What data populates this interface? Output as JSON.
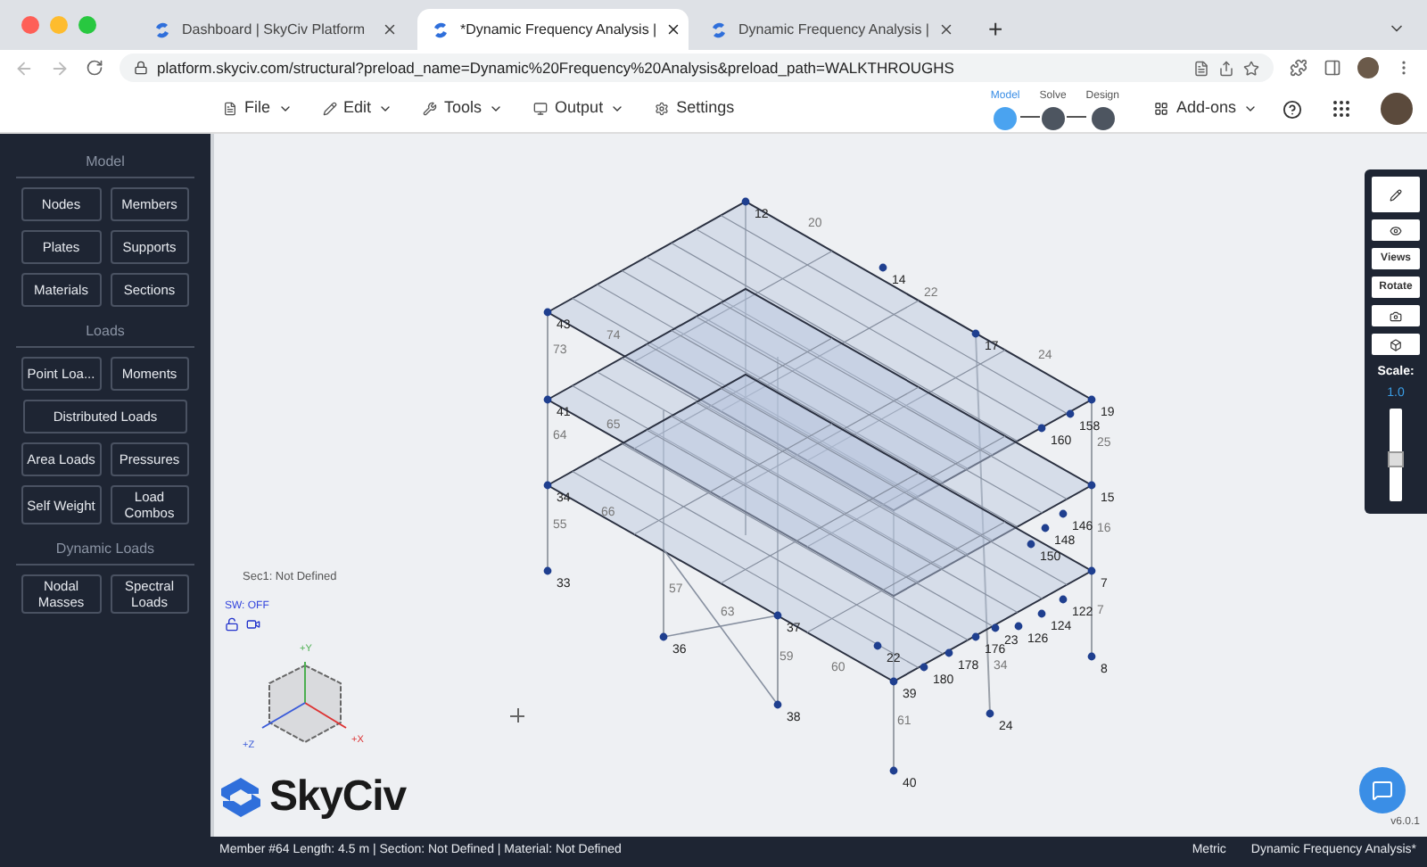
{
  "browser": {
    "tabs": [
      {
        "title": "Dashboard | SkyCiv Platform",
        "selected": false
      },
      {
        "title": "*Dynamic Frequency Analysis |",
        "selected": true
      },
      {
        "title": "Dynamic Frequency Analysis |",
        "selected": false
      }
    ],
    "new_tab": "+",
    "url": "platform.skyciv.com/structural?preload_name=Dynamic%20Frequency%20Analysis&preload_path=WALKTHROUGHS"
  },
  "toolbar": {
    "menus": [
      "File",
      "Edit",
      "Tools",
      "Output",
      "Settings"
    ],
    "steps": [
      {
        "label": "Model",
        "selected": true
      },
      {
        "label": "Solve",
        "selected": false
      },
      {
        "label": "Design",
        "selected": false
      }
    ],
    "addons": "Add-ons"
  },
  "sidebar": {
    "sections": [
      {
        "title": "Model",
        "buttons": [
          {
            "label": "Nodes",
            "wide": false
          },
          {
            "label": "Members",
            "wide": false
          },
          {
            "label": "Plates",
            "wide": false
          },
          {
            "label": "Supports",
            "wide": false
          },
          {
            "label": "Materials",
            "wide": false
          },
          {
            "label": "Sections",
            "wide": false
          }
        ]
      },
      {
        "title": "Loads",
        "buttons": [
          {
            "label": "Point Loa...",
            "wide": false
          },
          {
            "label": "Moments",
            "wide": false
          },
          {
            "label": "Distributed Loads",
            "wide": true
          },
          {
            "label": "Area Loads",
            "wide": false
          },
          {
            "label": "Pressures",
            "wide": false
          },
          {
            "label": "Self Weight",
            "wide": false
          },
          {
            "label": "Load Combos",
            "wide": false
          }
        ]
      },
      {
        "title": "Dynamic Loads",
        "buttons": [
          {
            "label": "Nodal Masses",
            "wide": false
          },
          {
            "label": "Spectral Loads",
            "wide": false
          }
        ]
      }
    ]
  },
  "canvas": {
    "section_info": "Sec1: Not Defined",
    "self_weight": "SW: OFF",
    "axes": [
      "+Y",
      "+X",
      "+Z"
    ],
    "node_labels": [
      "12",
      "14",
      "17",
      "19",
      "43",
      "41",
      "34",
      "33",
      "15",
      "7",
      "8",
      "39",
      "40",
      "24",
      "38",
      "36",
      "37",
      "22",
      "23",
      "160",
      "158",
      "146",
      "148",
      "150",
      "122",
      "124",
      "126",
      "176",
      "178",
      "180"
    ],
    "member_labels": [
      "20",
      "22",
      "24",
      "73",
      "64",
      "55",
      "25",
      "16",
      "7",
      "61",
      "57",
      "59",
      "34",
      "74",
      "65",
      "66",
      "63",
      "60"
    ],
    "logo": "SkyCiv",
    "version": "v6.0.1"
  },
  "right_toolbar": {
    "buttons": [
      {
        "kind": "pencil"
      },
      {
        "kind": "eye"
      },
      {
        "kind": "text",
        "label": "Views"
      },
      {
        "kind": "text",
        "label": "Rotate"
      },
      {
        "kind": "camera"
      },
      {
        "kind": "cube"
      }
    ],
    "scale_label": "Scale:",
    "scale_value": "1.0",
    "scale": {
      "level": 0.45
    }
  },
  "status_bar": {
    "info": "Member #64 Length: 4.5 m | Section: Not Defined | Material: Not Defined",
    "units": "Metric",
    "project": "Dynamic Frequency Analysis*"
  }
}
